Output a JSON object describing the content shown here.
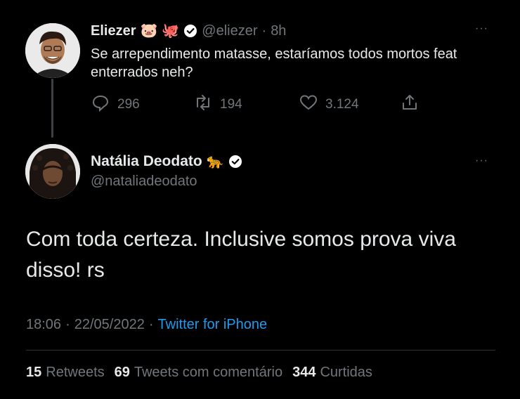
{
  "parent_tweet": {
    "author_name": "Eliezer",
    "author_emojis": [
      "🐷",
      "🐙"
    ],
    "handle": "@eliezer",
    "separator": "·",
    "time_ago": "8h",
    "text": "Se arrependimento matasse, estaríamos todos mortos feat enterrados neh?",
    "actions": {
      "replies": "296",
      "retweets": "194",
      "likes": "3.124"
    },
    "icons": [
      "reply-icon",
      "retweet-icon",
      "like-icon",
      "share-icon"
    ]
  },
  "reply_tweet": {
    "author_name": "Natália Deodato",
    "author_emoji": "🐆",
    "handle": "@nataliadeodato",
    "text": "Com toda certeza. Inclusive somos prova viva disso! rs",
    "time": "18:06",
    "date": "22/05/2022",
    "separator": "·",
    "source": "Twitter for iPhone",
    "stats": {
      "retweets_count": "15",
      "retweets_label": "Retweets",
      "quotes_count": "69",
      "quotes_label": "Tweets com comentário",
      "likes_count": "344",
      "likes_label": "Curtidas"
    }
  },
  "more_label": "···",
  "colors": {
    "background": "#000000",
    "text": "#e7e9ea",
    "muted": "#71767b",
    "link": "#1d9bf0",
    "verified": "#ffffff"
  }
}
